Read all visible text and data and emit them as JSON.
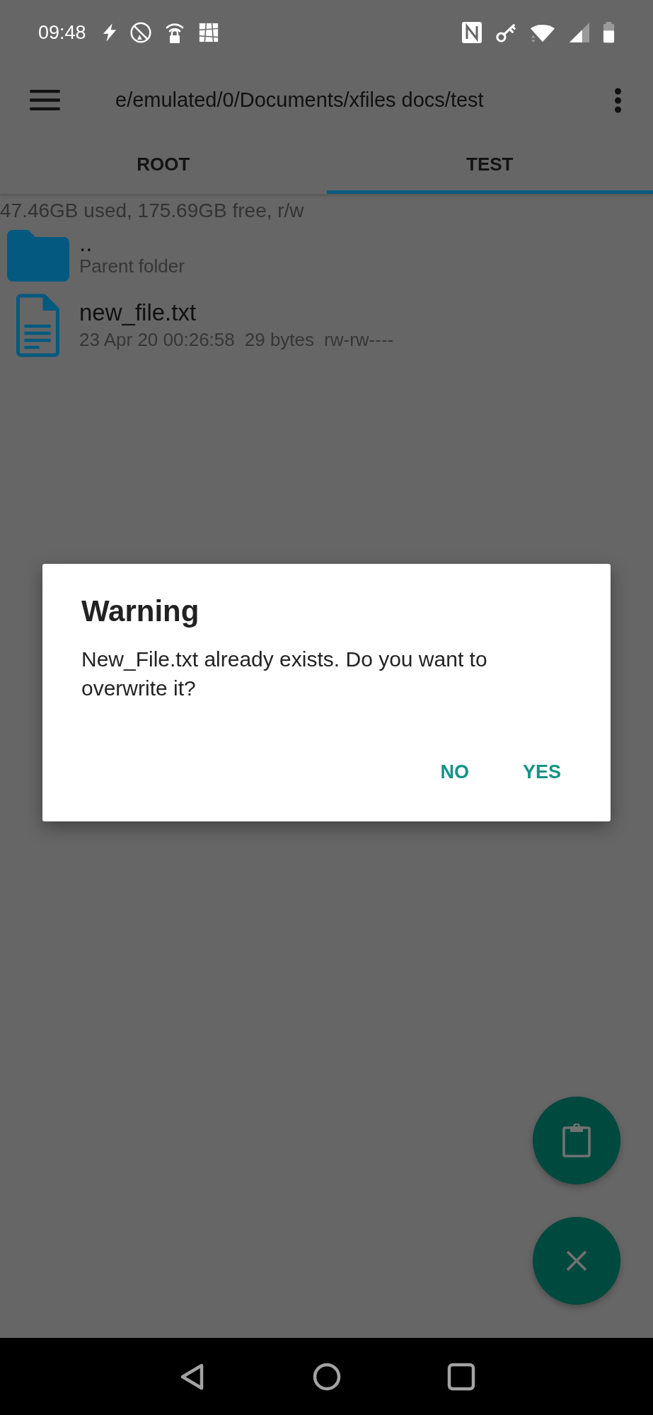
{
  "status_bar": {
    "time": "09:48"
  },
  "toolbar": {
    "path": "e/emulated/0/Documents/xfiles docs/test"
  },
  "tabs": [
    {
      "label": "ROOT",
      "selected": false
    },
    {
      "label": "TEST",
      "selected": true
    }
  ],
  "storage_info": "47.46GB used, 175.69GB free, r/w",
  "files": [
    {
      "kind": "folder",
      "name": "..",
      "subtitle": "Parent folder"
    },
    {
      "kind": "file",
      "name": "new_file.txt",
      "date": "23 Apr 20 00:26:58",
      "size": "29 bytes",
      "permissions": "rw-rw----"
    }
  ],
  "dialog": {
    "title": "Warning",
    "message": "New_File.txt already exists. Do you want to overwrite it?",
    "buttons": [
      "NO",
      "YES"
    ]
  }
}
